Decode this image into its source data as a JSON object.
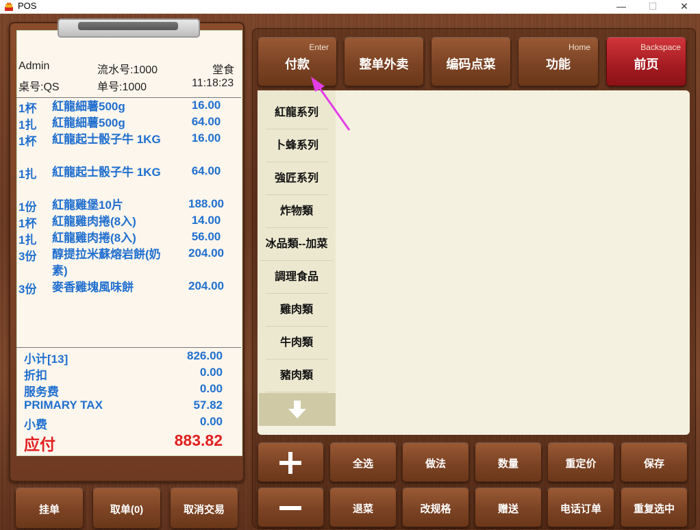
{
  "window": {
    "title": "POS",
    "min": "—",
    "max": "☐",
    "close": "✕"
  },
  "receipt": {
    "user": "Admin",
    "serial": "流水号:1000",
    "type": "堂食",
    "table": "桌号:QS",
    "order_no": "单号:1000",
    "time": "11:18:23",
    "items": [
      {
        "qty": "1杯",
        "name": "紅龍細薯500g",
        "price": "16.00"
      },
      {
        "qty": "1扎",
        "name": "紅龍細薯500g",
        "price": "64.00"
      },
      {
        "qty": "1杯",
        "name": "紅龍起士骰子牛 1KG",
        "price": "16.00"
      },
      {
        "qty": "1扎",
        "name": "紅龍起士骰子牛 1KG",
        "price": "64.00"
      },
      {
        "qty": "1份",
        "name": "紅龍雞堡10片",
        "price": "188.00"
      },
      {
        "qty": "1杯",
        "name": "紅龍雞肉捲(8入)",
        "price": "14.00"
      },
      {
        "qty": "1扎",
        "name": "紅龍雞肉捲(8入)",
        "price": "56.00"
      },
      {
        "qty": "3份",
        "name": "醇提拉米蘇熔岩餅(奶素)",
        "price": "204.00"
      },
      {
        "qty": "3份",
        "name": "麥香雞塊風味餅",
        "price": "204.00"
      }
    ],
    "summary": [
      {
        "label": "小计[13]",
        "value": "826.00"
      },
      {
        "label": "折扣",
        "value": "0.00"
      },
      {
        "label": "服务费",
        "value": "0.00"
      },
      {
        "label": "PRIMARY TAX",
        "value": "57.82"
      },
      {
        "label": "小费",
        "value": "0.00"
      }
    ],
    "total": {
      "label": "应付",
      "value": "883.82"
    }
  },
  "bottom_left": [
    "挂单",
    "取单(0)",
    "取消交易"
  ],
  "top_buttons": [
    {
      "label": "付款",
      "key": "Enter"
    },
    {
      "label": "整单外卖",
      "key": ""
    },
    {
      "label": "编码点菜",
      "key": ""
    },
    {
      "label": "功能",
      "key": "Home"
    },
    {
      "label": "前页",
      "key": "Backspace"
    }
  ],
  "categories": [
    "紅龍系列",
    "卜蜂系列",
    "強匠系列",
    "炸物類",
    "冰品類--加菜",
    "調理食品",
    "雞肉類",
    "牛肉類",
    "豬肉類"
  ],
  "action_row1": [
    "全选",
    "做法",
    "数量",
    "重定价",
    "保存"
  ],
  "action_row2": [
    "退菜",
    "改规格",
    "赠送",
    "电话订单",
    "重复选中"
  ],
  "colors": {
    "accent_blue": "#1f6fcf",
    "total_red": "#e21f1f",
    "red_button": "#b0222a",
    "panel_bg": "#f4f1e0"
  }
}
